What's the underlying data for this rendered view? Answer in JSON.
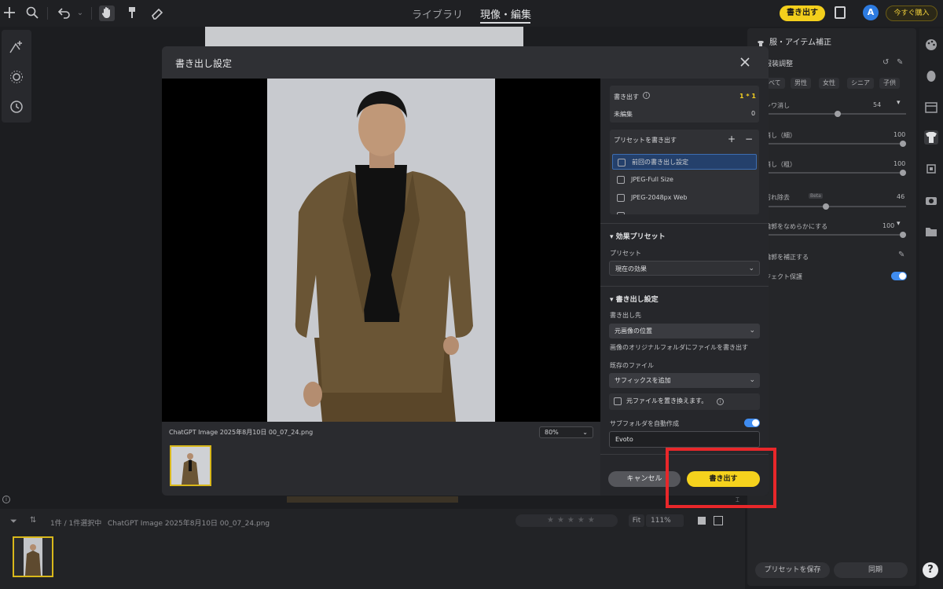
{
  "topbar": {
    "tab_library": "ライブラリ",
    "tab_develop": "現像・編集",
    "export_label": "書き出す",
    "avatar_letter": "A",
    "buy_label": "今すぐ購入"
  },
  "right_panel": {
    "title": "服・アイテム補正",
    "subtitle": "服装調整",
    "chips": [
      "べて",
      "男性",
      "女性",
      "シニア",
      "子供"
    ],
    "sliders": [
      {
        "label": "シワ消し",
        "value": "54"
      },
      {
        "label": "消し（細）",
        "value": "100"
      },
      {
        "label": "消し（粗）",
        "value": "100"
      },
      {
        "label": "汚れ除去",
        "badge": "Beta",
        "value": "46"
      },
      {
        "label": "輪郭をなめらかにする",
        "value": "100"
      }
    ],
    "correct_outline": "輪郭を補正する",
    "protect": "ジェクト保護",
    "save_preset": "プリセットを保存",
    "sync": "同期"
  },
  "bottombar": {
    "info": "1件 / 1件選択中",
    "filename": "ChatGPT Image 2025年8月10日 00_07_24.png",
    "stars": "★★★★★",
    "fit": "Fit",
    "zoom": "111%"
  },
  "dialog": {
    "title": "書き出し設定",
    "filename": "ChatGPT Image 2025年8月10日 00_07_24.png",
    "zoom": "80%",
    "summary": {
      "export_label": "書き出す",
      "export_value": "1 * 1",
      "unedited_label": "未編集",
      "unedited_value": "0"
    },
    "presets": {
      "title": "プリセットを書き出す",
      "add": "+",
      "remove": "−",
      "items": [
        "前回の書き出し設定",
        "JPEG-Full Size",
        "JPEG-2048px Web"
      ]
    },
    "effect_presets": {
      "title": "効果プリセット",
      "preset_label": "プリセット",
      "preset_value": "現在の効果"
    },
    "export_settings": {
      "title": "書き出し設定",
      "destination_label": "書き出し先",
      "destination_value": "元画像の位置",
      "destination_note": "画像のオリジナルフォルダにファイルを書き出す",
      "existing_label": "既存のファイル",
      "existing_value": "サフィックスを追加",
      "replace_label": "元ファイルを置き換えます。",
      "subfolder_label": "サブフォルダを自動作成",
      "subfolder_value": "Evoto"
    },
    "cancel": "キャンセル",
    "export": "書き出す"
  },
  "colors": {
    "accent_yellow": "#f5d21d",
    "toggle_blue": "#3f8cf0",
    "highlight_red": "#e8272a"
  }
}
